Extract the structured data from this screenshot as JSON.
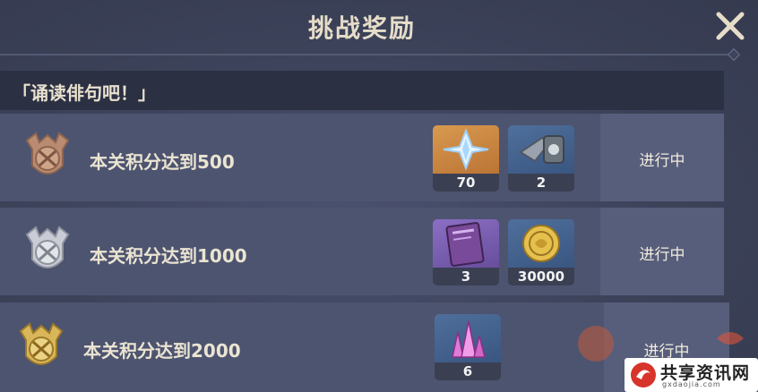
{
  "header": {
    "title": "挑战奖励",
    "close_icon": "close-x-icon"
  },
  "section": {
    "title": "「诵读俳句吧！」"
  },
  "rows": [
    {
      "medal": "bronze-medal-icon",
      "label": "本关积分达到500",
      "status": "进行中",
      "rewards": [
        {
          "icon": "primogem-icon",
          "count": "70"
        },
        {
          "icon": "crown-item-icon",
          "count": "2"
        }
      ]
    },
    {
      "medal": "silver-medal-icon",
      "label": "本关积分达到1000",
      "status": "进行中",
      "rewards": [
        {
          "icon": "hero-wit-book-icon",
          "count": "3"
        },
        {
          "icon": "mora-coin-icon",
          "count": "30000"
        }
      ]
    },
    {
      "medal": "gold-medal-icon",
      "label": "本关积分达到2000",
      "status": "进行中",
      "rewards": [
        {
          "icon": "crystal-ore-icon",
          "count": "6"
        }
      ]
    }
  ],
  "watermark": {
    "site_name": "共享资讯网",
    "site_url": "gxdaojia.com"
  },
  "colors": {
    "title": "#e6ddc9",
    "row_bg": "#4d5470",
    "section_bg": "#2c3043",
    "gold": "#d9b65a",
    "silver": "#c9ccd4",
    "bronze": "#b98b70"
  }
}
